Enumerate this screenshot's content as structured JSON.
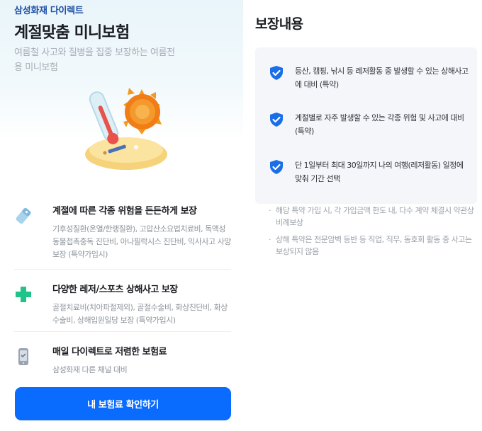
{
  "brand": "삼성화재 다이렉트",
  "hero": {
    "title": "계절맞춤 미니보험",
    "subtitle": "여름철 사고와 질병을 집중 보장하는 여름전용 미니보험"
  },
  "features": [
    {
      "icon": "pill-tag-icon",
      "title": "계절에 따른 각종 위험을 든든하게 보장",
      "desc": "기후성질환(온열/한랭질환), 고압산소요법치료비, 독액성동물접촉중독 진단비, 아나필락시스 진단비, 익사사고 사망 보장 (특약가입시)"
    },
    {
      "icon": "medical-cross-icon",
      "title": "다양한 레저/스포츠 상해사고 보장",
      "desc": "골절치료비(치아파절제외), 골절수술비, 화상진단비, 화상수술비, 상해입원일당 보장 (특약가입시)"
    },
    {
      "icon": "mobile-phone-icon",
      "title": "매일 다이렉트로 저렴한 보험료",
      "desc": "삼성화재 다른 채널 대비"
    }
  ],
  "cta_label": "내 보험료 확인하기",
  "coverage": {
    "title": "보장내용",
    "items": [
      "등산, 캠핑, 낚시 등 레저활동 중 발생할 수 있는 상해사고에 대비 (특약)",
      "계절별로 자주 발생할 수 있는 각종 위험 및 사고에 대비 (특약)",
      "단 1일부터 최대 30일까지 나의 여행(레저활동) 일정에 맞춰 기간 선택"
    ],
    "notes": [
      "해당 특약 가입 시, 각 가입금액 한도 내, 다수 계약 체결시 약관상 비례보상",
      "상해 특약은 전문암벽 등반 등 직업, 직무, 동호회 활동 중 사고는 보상되지 않음"
    ]
  },
  "colors": {
    "accent": "#0a6bff",
    "brand_text": "#1f4fa8",
    "shield": "#1a6ee8",
    "cross": "#1fc48a"
  }
}
